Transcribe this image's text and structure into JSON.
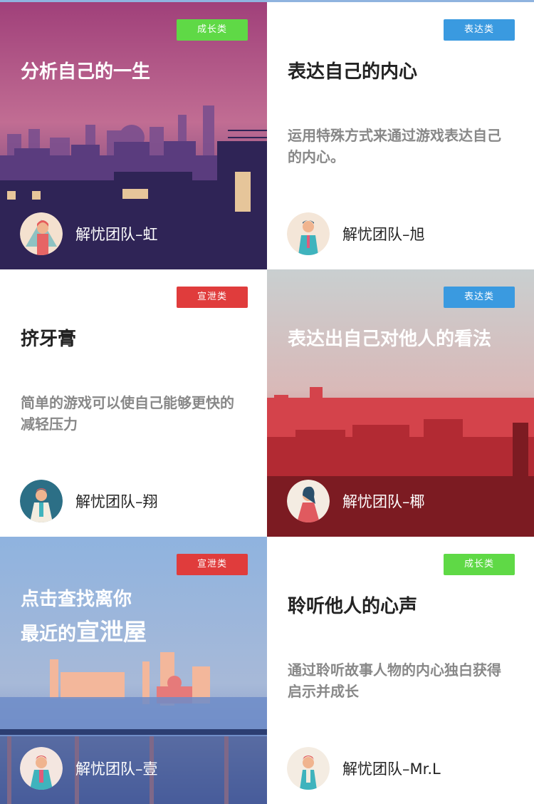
{
  "colors": {
    "growth": "#5fd946",
    "express": "#3a9ae0",
    "vent": "#e03c3c"
  },
  "cards": [
    {
      "badge": "成长类",
      "title": "分析自己的一生",
      "author": "解忧团队–虹",
      "avatar_icon": "woman-avatar-icon",
      "background": "purple-city-skyline-illustration"
    },
    {
      "badge": "表达类",
      "title": "表达自己的内心",
      "description": "运用特殊方式来通过游戏表达自己的内心。",
      "author": "解忧团队–旭",
      "avatar_icon": "man-avatar-icon"
    },
    {
      "badge": "宣泄类",
      "title": "挤牙膏",
      "description": "简单的游戏可以使自己能够更快的减轻压力",
      "author": "解忧团队–翔",
      "avatar_icon": "man-avatar-icon"
    },
    {
      "badge": "表达类",
      "title": "表达出自己对他人的看法",
      "author": "解忧团队–椰",
      "avatar_icon": "woman-avatar-icon",
      "background": "red-city-skyline-illustration"
    },
    {
      "badge": "宣泄类",
      "title_line1": "点击查找离你",
      "title_line2_a": "最近的",
      "title_line2_b": "宣泄屋",
      "author": "解忧团队–壹",
      "avatar_icon": "man-avatar-icon",
      "background": "seaside-ruins-illustration"
    },
    {
      "badge": "成长类",
      "title": "聆听他人的心声",
      "description": "通过聆听故事人物的内心独白获得启示并成长",
      "author": "解忧团队–Mr.L",
      "avatar_icon": "man-avatar-icon"
    }
  ]
}
